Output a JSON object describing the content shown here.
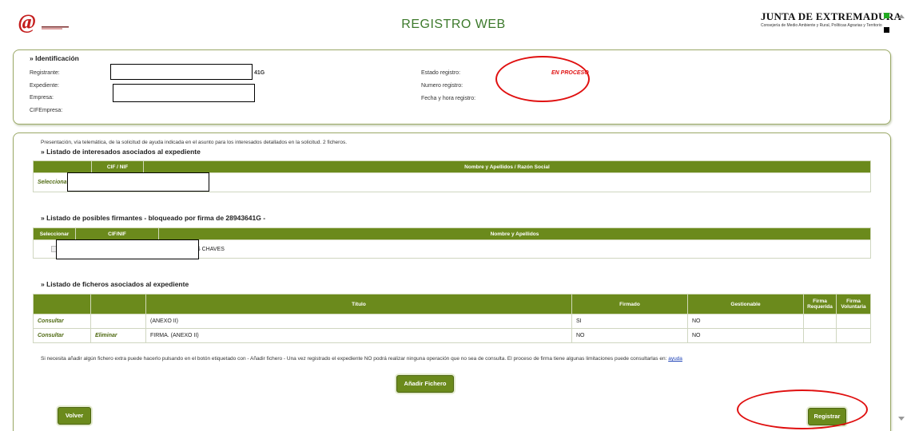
{
  "header": {
    "title": "REGISTRO WEB",
    "org_name": "JUNTA DE EXTREMADURA",
    "org_subtitle": "Consejería de Medio Ambiente y Rural, Políticas Agrarias y Territorio",
    "logo_symbol": "@"
  },
  "identificacion": {
    "section_title": "» Identificación",
    "fields": {
      "registrante_label": "Registrante:",
      "registrante_value": "41G",
      "expediente_label": "Expediente:",
      "empresa_label": "Empresa:",
      "cifempresa_label": "CIFEmpresa:",
      "estado_label": "Estado registro:",
      "estado_value": "EN PROCESO",
      "numero_label": "Numero registro:",
      "fecha_label": "Fecha y hora registro:"
    }
  },
  "presentacion": "Presentación, vía telemática, de la solicitud de ayuda indicada en el asunto para los interesados detallados en la solicitud.  2 ficheros.",
  "interesados": {
    "section_title": "» Listado de interesados asociados al expediente",
    "headers": [
      "",
      "CIF / NIF",
      "Nombre y Apellidos / Razón Social"
    ],
    "rows": [
      {
        "action": "Selecciona",
        "cif": "",
        "nombre": ""
      }
    ]
  },
  "firmantes": {
    "section_title": "» Listado de posibles firmantes - bloqueado por firma de 28943641G -",
    "headers": [
      "Seleccionar",
      "CIF/NIF",
      "Nombre y Apellidos"
    ],
    "rows": [
      {
        "cif": "",
        "nombre": "S CHAVES"
      }
    ]
  },
  "ficheros": {
    "section_title": "» Listado de ficheros asociados al expediente",
    "headers": [
      "",
      "",
      "Título",
      "Firmado",
      "Gestionable",
      "Firma Requerida",
      "Firma Voluntaria"
    ],
    "rows": [
      {
        "consultar": "Consultar",
        "eliminar": "",
        "titulo": "(ANEXO II)",
        "firmado": "SI",
        "gestionable": "NO"
      },
      {
        "consultar": "Consultar",
        "eliminar": "Eliminar",
        "titulo": "FIRMA. (ANEXO II)",
        "firmado": "NO",
        "gestionable": "NO"
      }
    ]
  },
  "info_text": "Si necesita añadir algún fichero extra puede hacerlo pulsando en el botón etiquetado con - Añadir fichero - Una vez registrado el expediente NO podrá realizar ninguna operación que no sea de consulta. El proceso de firma tiene algunas limitaciones puede consultarlas en:",
  "ayuda_link": "ayuda",
  "buttons": {
    "add_file": "Añadir Fichero",
    "back": "Volver",
    "register": "Registrar"
  },
  "colors": {
    "table_header": "#6b8a1c",
    "title_green": "#3d7a2c",
    "status_red": "#e01515",
    "annotation_red": "#e01010"
  }
}
